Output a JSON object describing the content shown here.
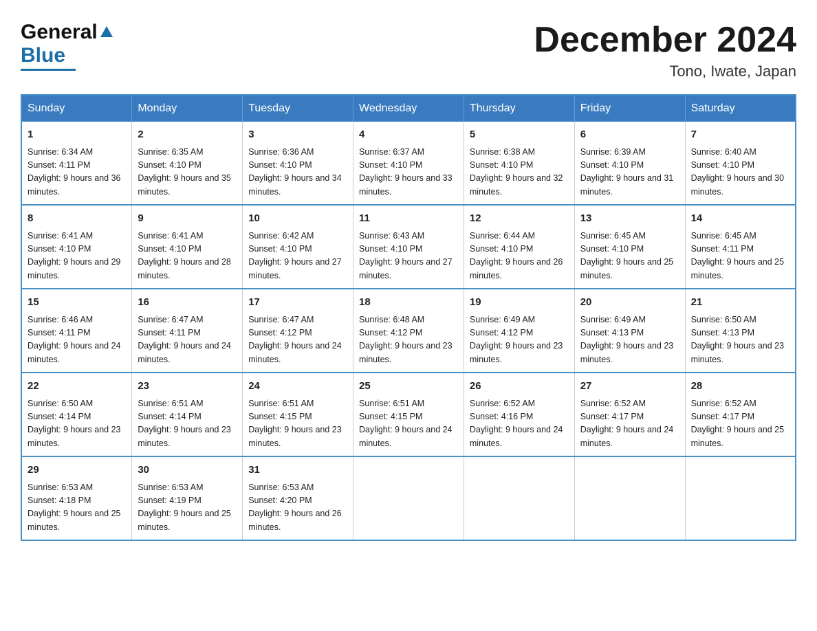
{
  "header": {
    "logo_general": "General",
    "logo_blue": "Blue",
    "month_title": "December 2024",
    "location": "Tono, Iwate, Japan"
  },
  "days_of_week": [
    "Sunday",
    "Monday",
    "Tuesday",
    "Wednesday",
    "Thursday",
    "Friday",
    "Saturday"
  ],
  "weeks": [
    [
      {
        "day": "1",
        "sunrise": "Sunrise: 6:34 AM",
        "sunset": "Sunset: 4:11 PM",
        "daylight": "Daylight: 9 hours and 36 minutes."
      },
      {
        "day": "2",
        "sunrise": "Sunrise: 6:35 AM",
        "sunset": "Sunset: 4:10 PM",
        "daylight": "Daylight: 9 hours and 35 minutes."
      },
      {
        "day": "3",
        "sunrise": "Sunrise: 6:36 AM",
        "sunset": "Sunset: 4:10 PM",
        "daylight": "Daylight: 9 hours and 34 minutes."
      },
      {
        "day": "4",
        "sunrise": "Sunrise: 6:37 AM",
        "sunset": "Sunset: 4:10 PM",
        "daylight": "Daylight: 9 hours and 33 minutes."
      },
      {
        "day": "5",
        "sunrise": "Sunrise: 6:38 AM",
        "sunset": "Sunset: 4:10 PM",
        "daylight": "Daylight: 9 hours and 32 minutes."
      },
      {
        "day": "6",
        "sunrise": "Sunrise: 6:39 AM",
        "sunset": "Sunset: 4:10 PM",
        "daylight": "Daylight: 9 hours and 31 minutes."
      },
      {
        "day": "7",
        "sunrise": "Sunrise: 6:40 AM",
        "sunset": "Sunset: 4:10 PM",
        "daylight": "Daylight: 9 hours and 30 minutes."
      }
    ],
    [
      {
        "day": "8",
        "sunrise": "Sunrise: 6:41 AM",
        "sunset": "Sunset: 4:10 PM",
        "daylight": "Daylight: 9 hours and 29 minutes."
      },
      {
        "day": "9",
        "sunrise": "Sunrise: 6:41 AM",
        "sunset": "Sunset: 4:10 PM",
        "daylight": "Daylight: 9 hours and 28 minutes."
      },
      {
        "day": "10",
        "sunrise": "Sunrise: 6:42 AM",
        "sunset": "Sunset: 4:10 PM",
        "daylight": "Daylight: 9 hours and 27 minutes."
      },
      {
        "day": "11",
        "sunrise": "Sunrise: 6:43 AM",
        "sunset": "Sunset: 4:10 PM",
        "daylight": "Daylight: 9 hours and 27 minutes."
      },
      {
        "day": "12",
        "sunrise": "Sunrise: 6:44 AM",
        "sunset": "Sunset: 4:10 PM",
        "daylight": "Daylight: 9 hours and 26 minutes."
      },
      {
        "day": "13",
        "sunrise": "Sunrise: 6:45 AM",
        "sunset": "Sunset: 4:10 PM",
        "daylight": "Daylight: 9 hours and 25 minutes."
      },
      {
        "day": "14",
        "sunrise": "Sunrise: 6:45 AM",
        "sunset": "Sunset: 4:11 PM",
        "daylight": "Daylight: 9 hours and 25 minutes."
      }
    ],
    [
      {
        "day": "15",
        "sunrise": "Sunrise: 6:46 AM",
        "sunset": "Sunset: 4:11 PM",
        "daylight": "Daylight: 9 hours and 24 minutes."
      },
      {
        "day": "16",
        "sunrise": "Sunrise: 6:47 AM",
        "sunset": "Sunset: 4:11 PM",
        "daylight": "Daylight: 9 hours and 24 minutes."
      },
      {
        "day": "17",
        "sunrise": "Sunrise: 6:47 AM",
        "sunset": "Sunset: 4:12 PM",
        "daylight": "Daylight: 9 hours and 24 minutes."
      },
      {
        "day": "18",
        "sunrise": "Sunrise: 6:48 AM",
        "sunset": "Sunset: 4:12 PM",
        "daylight": "Daylight: 9 hours and 23 minutes."
      },
      {
        "day": "19",
        "sunrise": "Sunrise: 6:49 AM",
        "sunset": "Sunset: 4:12 PM",
        "daylight": "Daylight: 9 hours and 23 minutes."
      },
      {
        "day": "20",
        "sunrise": "Sunrise: 6:49 AM",
        "sunset": "Sunset: 4:13 PM",
        "daylight": "Daylight: 9 hours and 23 minutes."
      },
      {
        "day": "21",
        "sunrise": "Sunrise: 6:50 AM",
        "sunset": "Sunset: 4:13 PM",
        "daylight": "Daylight: 9 hours and 23 minutes."
      }
    ],
    [
      {
        "day": "22",
        "sunrise": "Sunrise: 6:50 AM",
        "sunset": "Sunset: 4:14 PM",
        "daylight": "Daylight: 9 hours and 23 minutes."
      },
      {
        "day": "23",
        "sunrise": "Sunrise: 6:51 AM",
        "sunset": "Sunset: 4:14 PM",
        "daylight": "Daylight: 9 hours and 23 minutes."
      },
      {
        "day": "24",
        "sunrise": "Sunrise: 6:51 AM",
        "sunset": "Sunset: 4:15 PM",
        "daylight": "Daylight: 9 hours and 23 minutes."
      },
      {
        "day": "25",
        "sunrise": "Sunrise: 6:51 AM",
        "sunset": "Sunset: 4:15 PM",
        "daylight": "Daylight: 9 hours and 24 minutes."
      },
      {
        "day": "26",
        "sunrise": "Sunrise: 6:52 AM",
        "sunset": "Sunset: 4:16 PM",
        "daylight": "Daylight: 9 hours and 24 minutes."
      },
      {
        "day": "27",
        "sunrise": "Sunrise: 6:52 AM",
        "sunset": "Sunset: 4:17 PM",
        "daylight": "Daylight: 9 hours and 24 minutes."
      },
      {
        "day": "28",
        "sunrise": "Sunrise: 6:52 AM",
        "sunset": "Sunset: 4:17 PM",
        "daylight": "Daylight: 9 hours and 25 minutes."
      }
    ],
    [
      {
        "day": "29",
        "sunrise": "Sunrise: 6:53 AM",
        "sunset": "Sunset: 4:18 PM",
        "daylight": "Daylight: 9 hours and 25 minutes."
      },
      {
        "day": "30",
        "sunrise": "Sunrise: 6:53 AM",
        "sunset": "Sunset: 4:19 PM",
        "daylight": "Daylight: 9 hours and 25 minutes."
      },
      {
        "day": "31",
        "sunrise": "Sunrise: 6:53 AM",
        "sunset": "Sunset: 4:20 PM",
        "daylight": "Daylight: 9 hours and 26 minutes."
      },
      null,
      null,
      null,
      null
    ]
  ]
}
